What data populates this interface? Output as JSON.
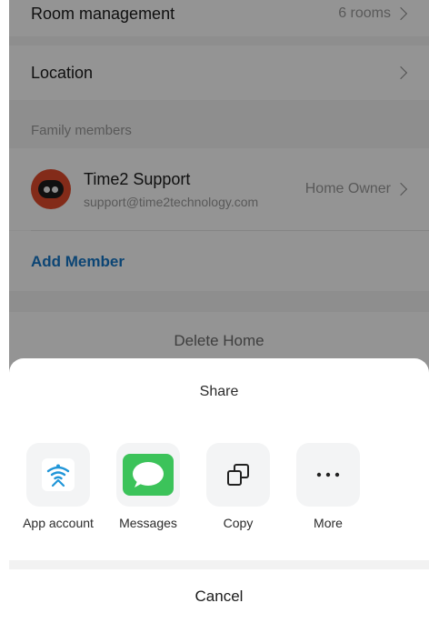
{
  "home_settings": {
    "room_management": {
      "label": "Room management",
      "value": "6 rooms"
    },
    "location": {
      "label": "Location"
    },
    "family_members_title": "Family members",
    "member": {
      "name": "Time2 Support",
      "email": "support@time2technology.com",
      "role": "Home Owner"
    },
    "add_member_label": "Add Member",
    "delete_home_label": "Delete Home"
  },
  "share_sheet": {
    "title": "Share",
    "options": [
      {
        "label": "App account",
        "icon": "wifi-icon"
      },
      {
        "label": "Messages",
        "icon": "message-bubble-icon"
      },
      {
        "label": "Copy",
        "icon": "copy-icon"
      },
      {
        "label": "More",
        "icon": "more-icon"
      }
    ],
    "cancel_label": "Cancel"
  },
  "colors": {
    "accent": "#1677c8",
    "messages_green": "#3cc35a",
    "wifi_blue": "#2196d8",
    "avatar_red": "#e24a2c"
  }
}
